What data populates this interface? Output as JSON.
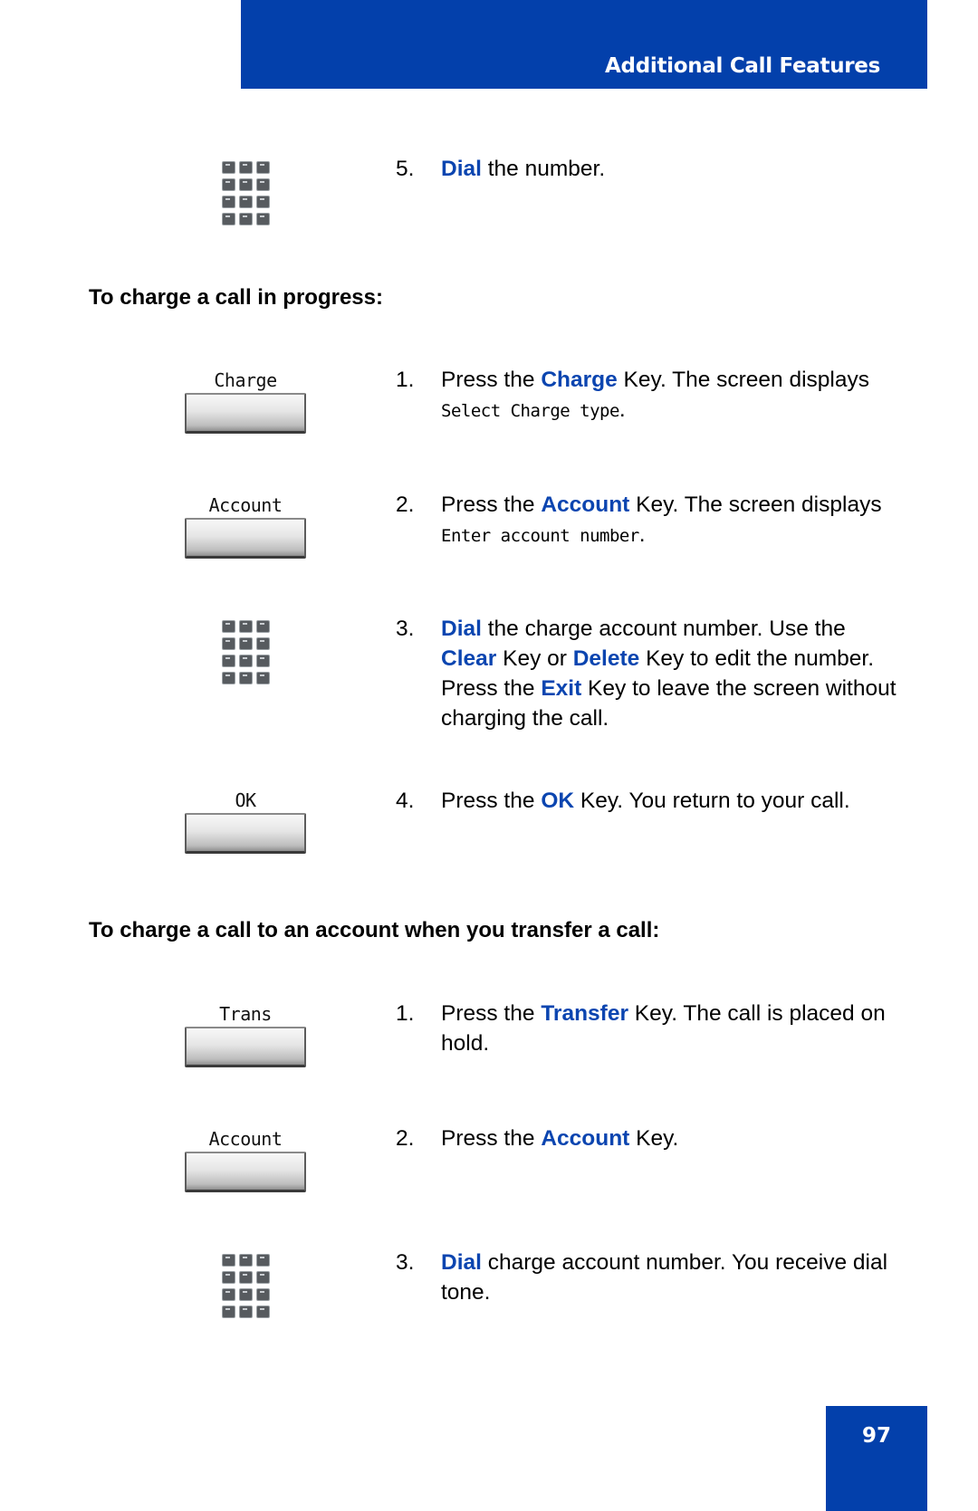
{
  "header": {
    "title": "Additional Call Features"
  },
  "page_number": "97",
  "colors": {
    "brand_blue": "#0340ab",
    "keyword_blue": "#0b45b0"
  },
  "section0": {
    "steps": [
      {
        "num": "5.",
        "icon": "keypad-icon",
        "parts": [
          {
            "t": "Dial",
            "k": true
          },
          {
            "t": " the number."
          }
        ]
      }
    ]
  },
  "section1": {
    "heading": "To charge a call in progress:",
    "steps": [
      {
        "num": "1.",
        "softkey": "Charge",
        "parts": [
          {
            "t": "Press the "
          },
          {
            "t": "Charge",
            "k": true
          },
          {
            "t": " Key. The screen displays "
          },
          {
            "t": "Select Charge type",
            "lcd": true
          },
          {
            "t": "."
          }
        ]
      },
      {
        "num": "2.",
        "softkey": "Account",
        "parts": [
          {
            "t": "Press the "
          },
          {
            "t": "Account",
            "k": true
          },
          {
            "t": " Key. The screen displays "
          },
          {
            "t": "Enter account number",
            "lcd": true
          },
          {
            "t": "."
          }
        ]
      },
      {
        "num": "3.",
        "icon": "keypad-icon",
        "parts": [
          {
            "t": "Dial",
            "k": true
          },
          {
            "t": " the charge account number. Use the "
          },
          {
            "t": "Clear",
            "k": true
          },
          {
            "t": " Key or "
          },
          {
            "t": "Delete",
            "k": true
          },
          {
            "t": " Key to edit the number. Press the "
          },
          {
            "t": "Exit",
            "k": true
          },
          {
            "t": " Key to leave the screen without charging the call."
          }
        ]
      },
      {
        "num": "4.",
        "softkey": "OK",
        "parts": [
          {
            "t": "Press the "
          },
          {
            "t": "OK",
            "k": true
          },
          {
            "t": " Key. You return to your call."
          }
        ]
      }
    ]
  },
  "section2": {
    "heading": "To charge a call to an account when you transfer a call:",
    "steps": [
      {
        "num": "1.",
        "softkey": "Trans",
        "parts": [
          {
            "t": "Press the "
          },
          {
            "t": "Transfer",
            "k": true
          },
          {
            "t": " Key. The call is placed on hold."
          }
        ]
      },
      {
        "num": "2.",
        "softkey": "Account",
        "parts": [
          {
            "t": "Press the "
          },
          {
            "t": "Account",
            "k": true
          },
          {
            "t": " Key."
          }
        ]
      },
      {
        "num": "3.",
        "icon": "keypad-icon",
        "parts": [
          {
            "t": "Dial",
            "k": true
          },
          {
            "t": " charge account number. You receive dial tone."
          }
        ]
      }
    ]
  }
}
